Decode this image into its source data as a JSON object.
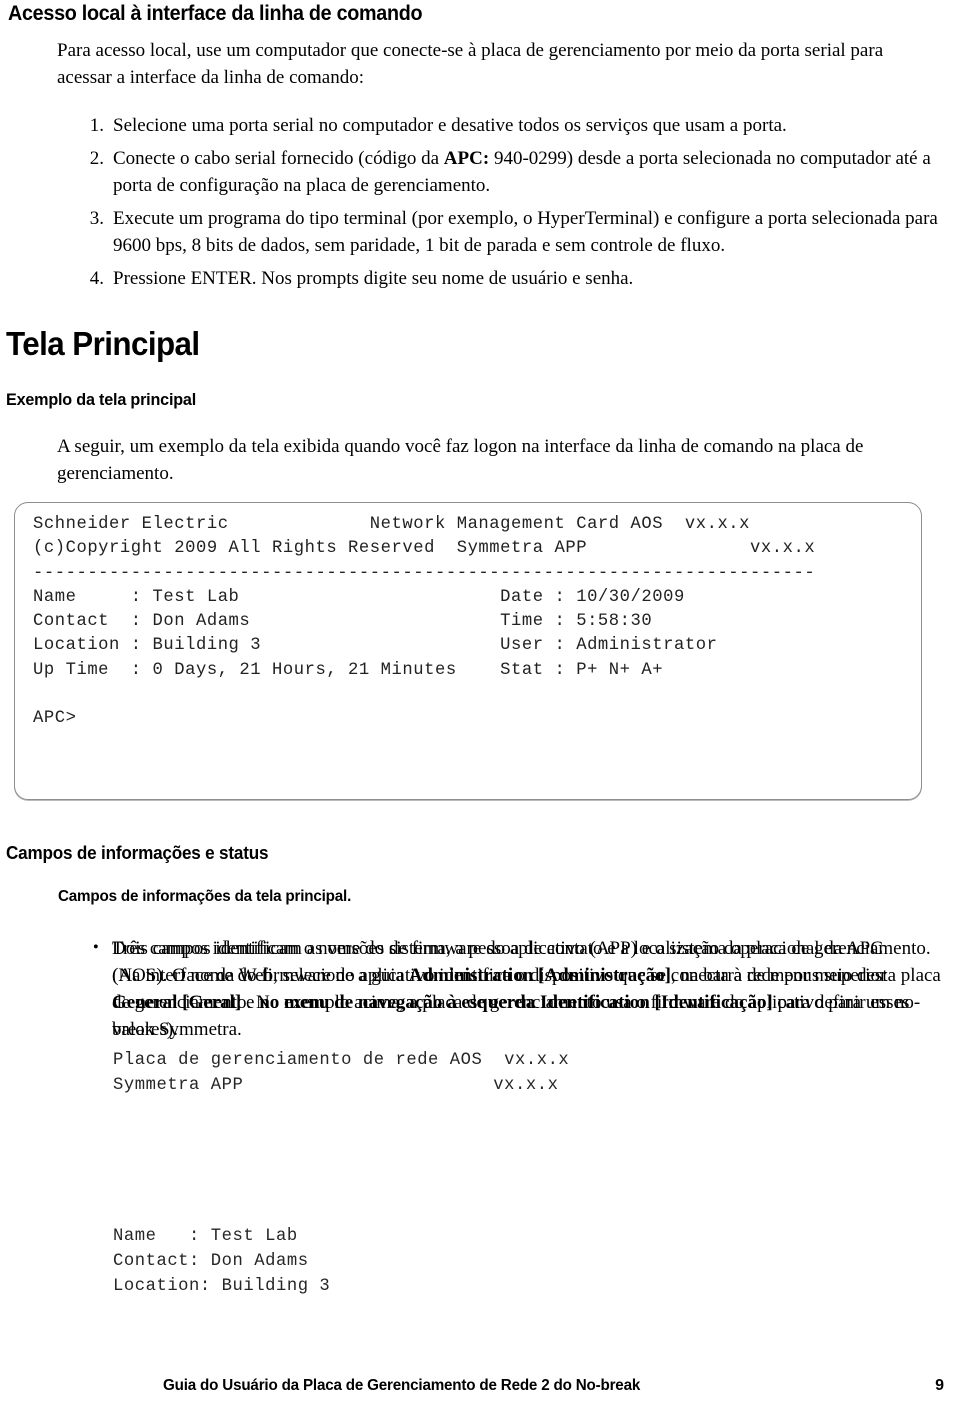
{
  "section": {
    "heading": "Acesso local à interface da linha de comando",
    "intro": "Para acesso local, use um computador que conecte-se à placa de gerenciamento por meio da porta serial para acessar a interface da linha de comando:"
  },
  "steps": [
    {
      "num": "1.",
      "text": "Selecione uma porta serial no computador e desative todos os serviços que usam a porta."
    },
    {
      "num": "2.",
      "pre": "Conecte o cabo serial fornecido (código da ",
      "bold": "APC:",
      "post": " 940-0299) desde a porta selecionada no computador até a porta de configuração na placa de gerenciamento."
    },
    {
      "num": "3.",
      "text": "Execute um programa do tipo terminal (por exemplo, o HyperTerminal) e configure a porta selecionada para 9600 bps, 8 bits de dados, sem paridade, 1 bit de parada e sem controle de fluxo."
    },
    {
      "num": "4.",
      "pre": "Pressione ",
      "smallcaps": "ENTER",
      "post": ". Nos prompts digite seu nome de usuário e senha."
    }
  ],
  "main_screen": {
    "title": "Tela Principal",
    "subtitle": "Exemplo da tela principal",
    "intro": "A seguir, um exemplo da tela exibida quando você faz logon na interface da linha de comando na placa de gerenciamento."
  },
  "terminal": {
    "lines": [
      "Schneider Electric             Network Management Card AOS  vx.x.x",
      "(c)Copyright 2009 All Rights Reserved  Symmetra APP               vx.x.x",
      "------------------------------------------------------------------------",
      "Name     : Test Lab                        Date : 10/30/2009",
      "Contact  : Don Adams                       Time : 5:58:30",
      "Location : Building 3                      User : Administrator",
      "Up Time  : 0 Days, 21 Hours, 21 Minutes    Stat : P+ N+ A+",
      "",
      "APC>"
    ],
    "fields": {
      "company": "Schneider Electric",
      "copyright": "(c)Copyright 2009 All Rights Reserved",
      "card_aos_label": "Network Management Card AOS",
      "card_aos_version": "vx.x.x",
      "app_label": "Symmetra APP",
      "app_version": "vx.x.x",
      "name_label": "Name",
      "name_value": "Test Lab",
      "contact_label": "Contact",
      "contact_value": "Don Adams",
      "location_label": "Location",
      "location_value": "Building 3",
      "uptime_label": "Up Time",
      "uptime_value": "0 Days, 21 Hours, 21 Minutes",
      "date_label": "Date",
      "date_value": "10/30/2009",
      "time_label": "Time",
      "time_value": "5:58:30",
      "user_label": "User",
      "user_value": "Administrator",
      "stat_label": "Stat",
      "stat_value": "P+ N+ A+",
      "prompt": "APC>"
    }
  },
  "status_section": {
    "heading": "Campos de informações e status",
    "subheading": "Campos de informações da tela principal.",
    "bullet1": "Dois campos identificam as versões de firmware do aplicativo (APP) e o sistema operacional da APC (AOS). O nome do firmware do aplicativo identifica o dispositivo que se conecta à rede por meio desta placa de gerenciamento. No exemplo acima, a placa de gerenciamento usa o firmware do aplicativo para um no-break Symmetra.",
    "code1": "Placa de gerenciamento de rede AOS  vx.x.x\nSymmetra APP                       vx.x.x",
    "bullet2": {
      "p1": "Três campos identificam o nome do sistema, a pessoa de contato e a localização da placa de gerenciamento. (Na interface da Web, selecione a guia ",
      "b1": "Administration [Administração]",
      "p2": ", na barra de menus superior ",
      "b2": "General [Geral]",
      "p3": " e ",
      "b3": "no menu de navegação à esquerda Identification [Identificação]",
      "p4": " para definir esses valores)."
    },
    "code2": "Name   : Test Lab\nContact: Don Adams\nLocation: Building 3"
  },
  "footer": {
    "title": "Guia do Usuário da Placa de Gerenciamento de Rede 2 do No-break",
    "page": "9"
  },
  "colors": {
    "text": "#000000",
    "terminal_text": "#222222",
    "box_border": "#8e8e8e",
    "background": "#ffffff"
  }
}
